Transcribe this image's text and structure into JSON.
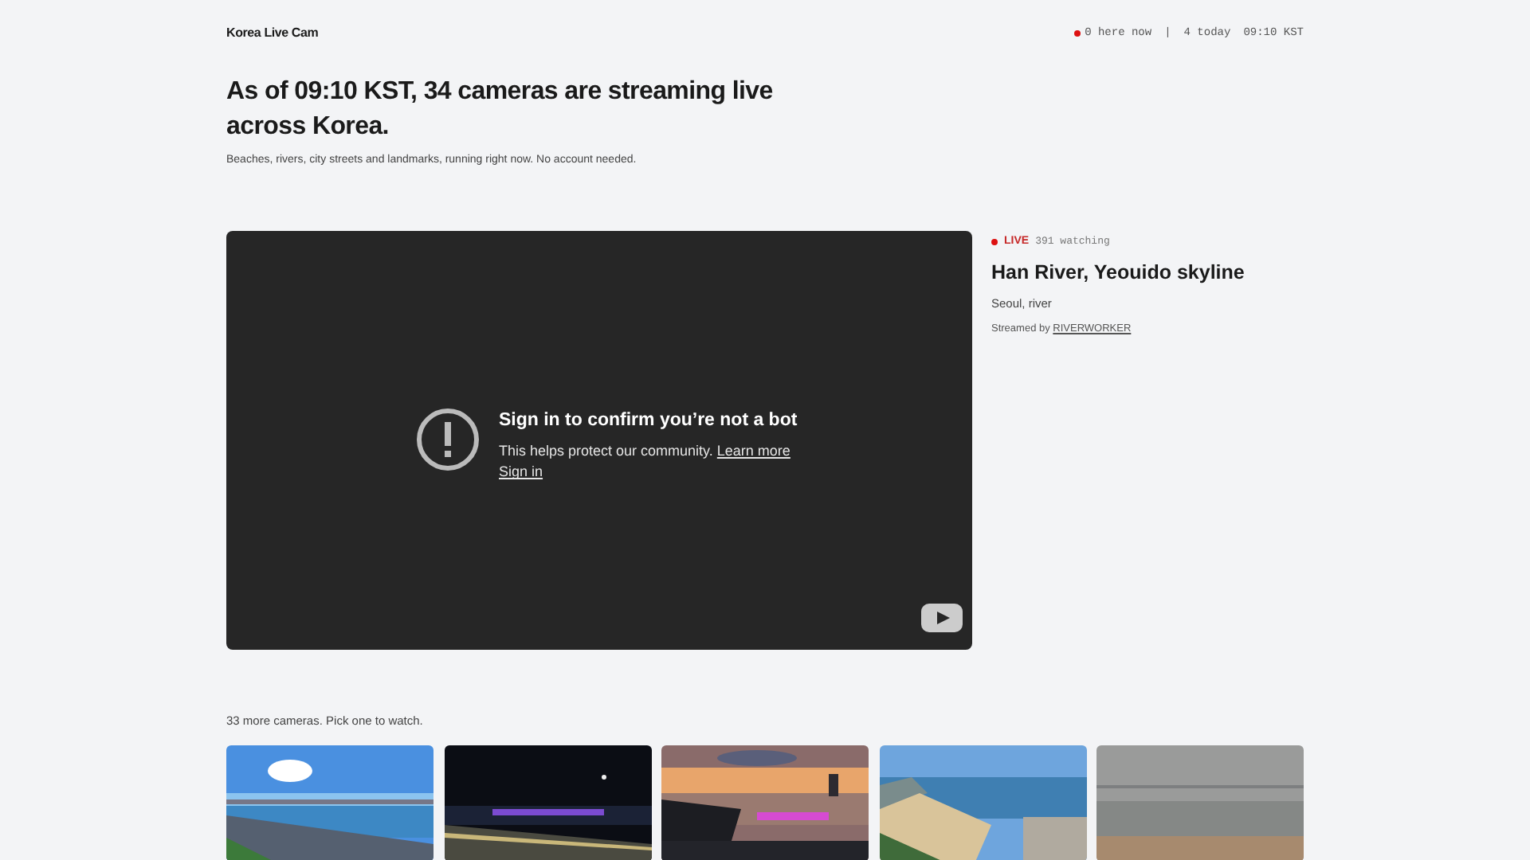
{
  "header": {
    "brand": "Korea Live Cam",
    "status": {
      "here_now": "0 here now",
      "separator": "|",
      "today": "4 today",
      "time": "09:10 KST"
    }
  },
  "hero": {
    "headline": "As of 09:10 KST, 34 cameras are streaming live across Korea.",
    "subtitle": "Beaches, rivers, city streets and landmarks, running right now. No account needed."
  },
  "player": {
    "notice_title": "Sign in to confirm you’re not a bot",
    "notice_text": "This helps protect our community.",
    "learn_more": "Learn more",
    "sign_in": "Sign in"
  },
  "now_playing": {
    "live": true,
    "live_label": "LIVE",
    "watching": "391 watching",
    "title": "Han River, Yeouido skyline",
    "tags": "Seoul, river",
    "streamed_by": "Streamed by",
    "streamer": "RIVERWORKER"
  },
  "more": {
    "caption": "33 more cameras. Pick one to watch."
  }
}
